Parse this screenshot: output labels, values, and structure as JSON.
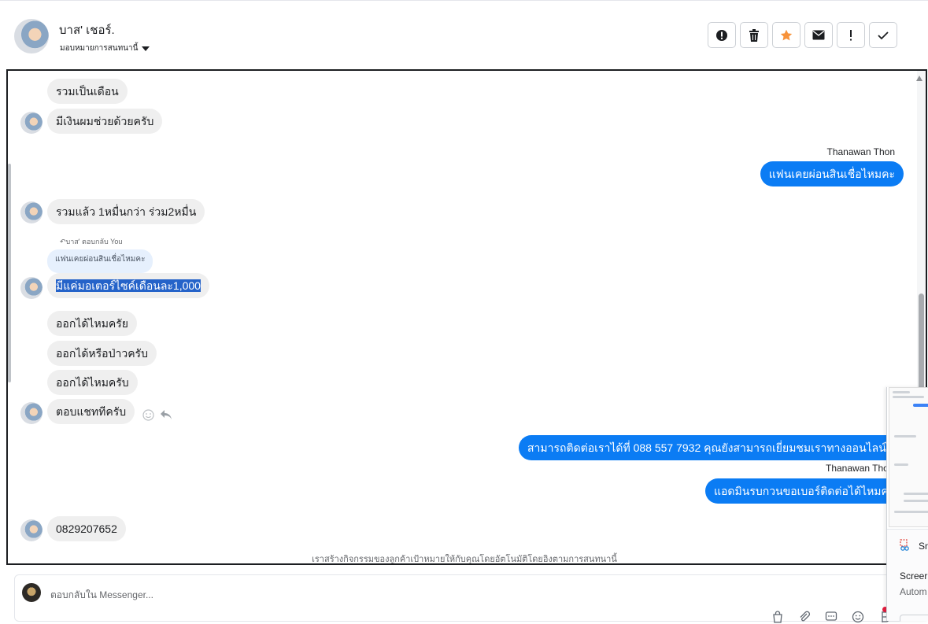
{
  "header": {
    "contact_name": "บาส' เชอร์.",
    "assign_label": "มอบหมายการสนทนานี้",
    "actions": [
      {
        "name": "info-button",
        "icon": "alert-circle-icon",
        "color": "#1c1e21"
      },
      {
        "name": "delete-button",
        "icon": "trash-icon",
        "color": "#1c1e21"
      },
      {
        "name": "star-button",
        "icon": "star-icon",
        "color": "#f7923a"
      },
      {
        "name": "mark-unread-button",
        "icon": "envelope-icon",
        "color": "#1c1e21"
      },
      {
        "name": "spam-button",
        "icon": "exclamation-icon",
        "color": "#1c1e21"
      },
      {
        "name": "done-button",
        "icon": "checkmark-icon",
        "color": "#1c1e21"
      }
    ]
  },
  "messages": {
    "m1": "รวมเป็นเดือน",
    "m2": "มีเงินผมช่วยด้วยครับ",
    "agent_name_1": "Thanawan Thon",
    "out1": "แฟนเคยผ่อนสินเชื่อไหมคะ",
    "m3": "รวมแล้ว 1หมื่นกว่า ร่วม2หมื่น",
    "reply_meta": "บาส' ตอบกลับ You",
    "quoted": "แฟนเคยผ่อนสินเชื่อไหมคะ",
    "m4": "มีแค่มอเตอร์ไซค์เดือนละ1,000",
    "m5": "ออกได้ไหมครัย",
    "m6": "ออกได้หรือป่าวครับ",
    "m7": "ออกได้ไหมครับ",
    "m8": "ตอบแชททีครับ",
    "out2": "สามารถติดต่อเราได้ที่ 088 557 7932 คุณยังสามารถเยี่ยมชมเราทางออนไลน์ได",
    "agent_name_2": "Thanawan Tho",
    "out3": "แอดมินรบกวนขอเบอร์ติดต่อได้ไหมคะ",
    "m9": "0829207652",
    "footer_note": "เราสร้างกิจกรรมของลูกค้าเป้าหมายให้กับคุณโดยอัตโนมัติโดยอิงตามการสนทนานี้"
  },
  "composer": {
    "placeholder": "ตอบกลับใน Messenger..."
  },
  "overlay": {
    "title": "Sn",
    "line1": "Screer",
    "line2": "Autom"
  },
  "colors": {
    "outgoing_bubble": "#0b7cf4",
    "incoming_bubble": "#efefef",
    "star": "#f7923a"
  }
}
